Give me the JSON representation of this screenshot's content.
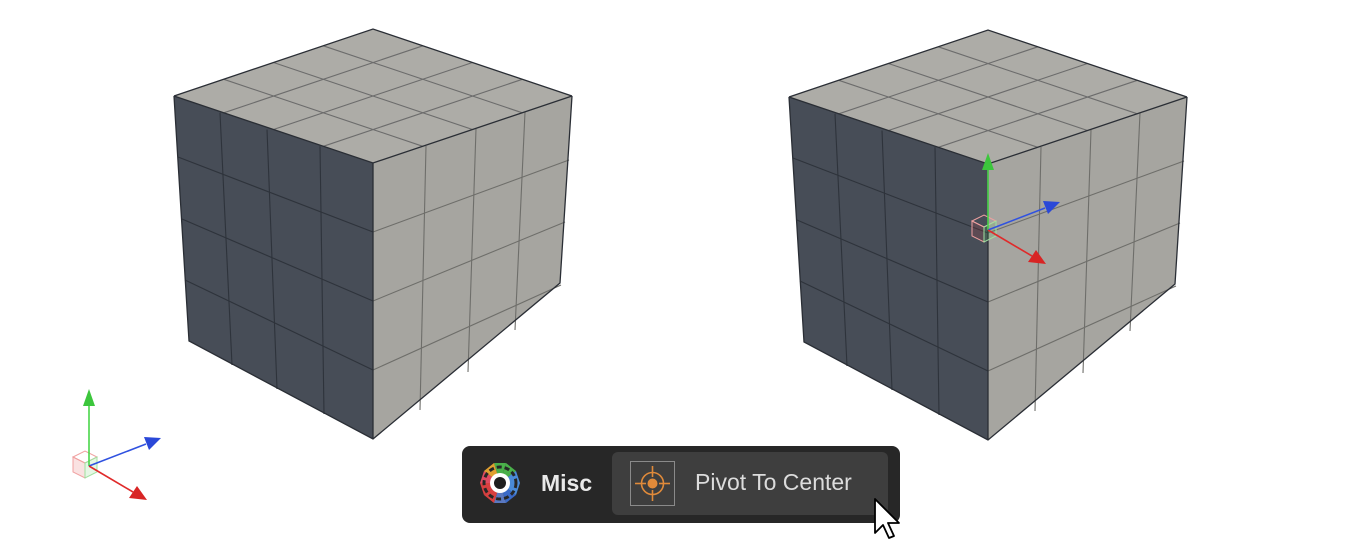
{
  "toolbar": {
    "category_label": "Misc",
    "category_icon": "gear-icon",
    "action_label": "Pivot To Center",
    "action_icon": "pivot-target-icon"
  },
  "colors": {
    "cube_light_face": "#a9a8a3",
    "cube_dark_face": "#474d57",
    "axis_x": "#e02a2a",
    "axis_y": "#4ad64a",
    "axis_z": "#3052e0",
    "pivot_accent": "#e08a3a",
    "toolbar_bg": "#272727",
    "button_bg": "#3e3e3e"
  }
}
